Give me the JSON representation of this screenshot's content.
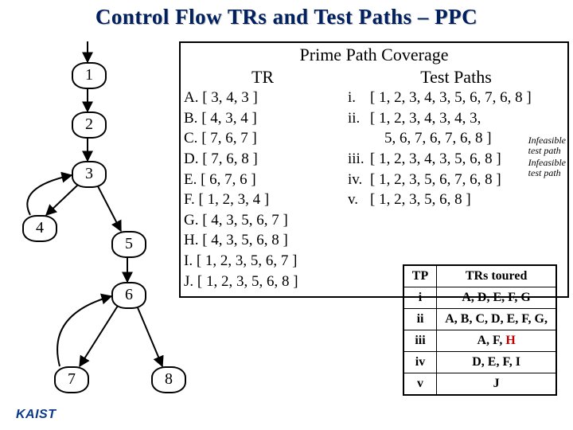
{
  "title": "Control Flow TRs and Test Paths – PPC",
  "ppc": {
    "heading": "Prime Path Coverage",
    "tr_head": "TR",
    "tp_head": "Test Paths",
    "tr": {
      "A": "[ 3, 4, 3 ]",
      "B": "[ 4, 3, 4 ]",
      "C": "[ 7, 6, 7 ]",
      "D": "[ 7, 6, 8 ]",
      "E": "[ 6, 7, 6 ]",
      "F": "[ 1, 2, 3, 4 ]",
      "G": "[ 4, 3, 5, 6, 7 ]",
      "H": "[ 4, 3, 5, 6, 8 ]",
      "I": "[ 1, 2, 3, 5, 6, 7 ]",
      "J": "[ 1, 2, 3, 5, 6, 8 ]"
    },
    "tp": {
      "i": "[ 1, 2, 3, 4, 3, 5, 6, 7, 6, 8 ]",
      "ii_a": "[ 1, 2, 3, 4, 3, 4, 3,",
      "ii_b": "5, 6, 7, 6, 7, 6, 8 ]",
      "iii": "[ 1, 2, 3, 4, 3, 5, 6, 8 ]",
      "iv": "[ 1, 2, 3, 5, 6, 7, 6, 8 ]",
      "v": "[ 1, 2, 3, 5, 6, 8 ]"
    },
    "infeasible_label": "Infeasible test path"
  },
  "tours": {
    "head_tp": "TP",
    "head_trs": "TRs toured",
    "rows": [
      {
        "tp": "i",
        "trs": "A, D, E, F, G"
      },
      {
        "tp": "ii",
        "trs": "A, B, C, D, E, F, G,"
      },
      {
        "tp": "iii",
        "trs_pre": "A, F, ",
        "trs_red": "H"
      },
      {
        "tp": "iv",
        "trs": "D, E, F, I"
      },
      {
        "tp": "v",
        "trs": "J"
      }
    ]
  },
  "nodes": {
    "n1": "1",
    "n2": "2",
    "n3": "3",
    "n4": "4",
    "n5": "5",
    "n6": "6",
    "n7": "7",
    "n8": "8"
  },
  "logo": "KAIST"
}
